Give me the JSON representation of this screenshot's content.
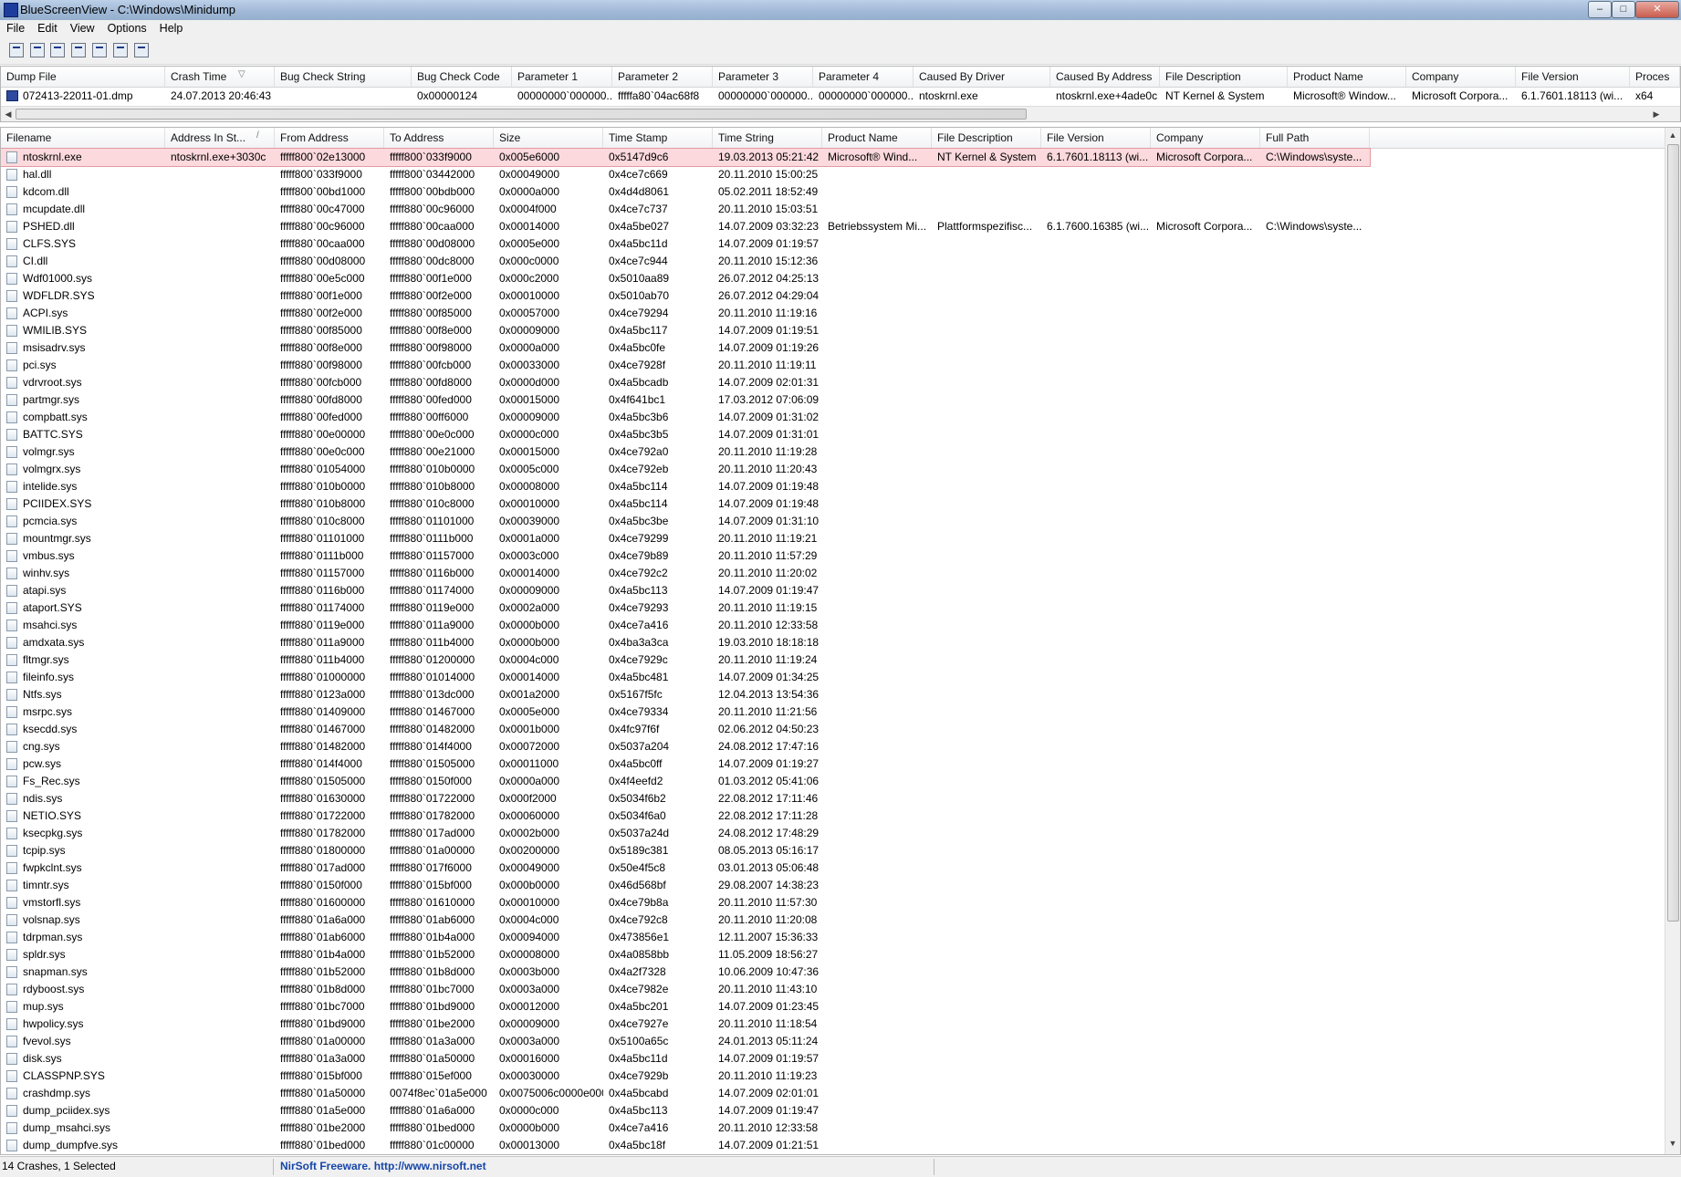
{
  "window": {
    "title": "BlueScreenView  -  C:\\Windows\\Minidump",
    "minimize": "–",
    "maximize": "□",
    "close": "✕"
  },
  "menu": [
    "File",
    "Edit",
    "View",
    "Options",
    "Help"
  ],
  "toolbar": [
    "save-icon",
    "save-selected-icon",
    "refresh-icon",
    "copy-icon",
    "properties-icon",
    "find-icon",
    "exit-icon"
  ],
  "dumps": {
    "columns": [
      "Dump File",
      "Crash Time",
      "Bug Check String",
      "Bug Check Code",
      "Parameter 1",
      "Parameter 2",
      "Parameter 3",
      "Parameter 4",
      "Caused By Driver",
      "Caused By Address",
      "File Description",
      "Product Name",
      "Company",
      "File Version",
      "Proces"
    ],
    "sort_indicator": "▽",
    "rows": [
      [
        "072413-22011-01.dmp",
        "24.07.2013 20:46:43",
        "",
        "0x00000124",
        "00000000`000000...",
        "fffffa80`04ac68f8",
        "00000000`000000...",
        "00000000`000000...",
        "ntoskrnl.exe",
        "ntoskrnl.exe+4ade0c",
        "NT Kernel & System",
        "Microsoft® Window...",
        "Microsoft Corpora...",
        "6.1.7601.18113 (wi...",
        "x64"
      ]
    ]
  },
  "drivers": {
    "columns": [
      "Filename",
      "Address In St...",
      "From Address",
      "To Address",
      "Size",
      "Time Stamp",
      "Time String",
      "Product Name",
      "File Description",
      "File Version",
      "Company",
      "Full Path"
    ],
    "sort_indicator": "/",
    "rows": [
      [
        "ntoskrnl.exe",
        "ntoskrnl.exe+3030c",
        "fffff800`02e13000",
        "fffff800`033f9000",
        "0x005e6000",
        "0x5147d9c6",
        "19.03.2013 05:21:42",
        "Microsoft® Wind...",
        "NT Kernel & System",
        "6.1.7601.18113 (wi...",
        "Microsoft Corpora...",
        "C:\\Windows\\syste..."
      ],
      [
        "hal.dll",
        "",
        "fffff800`033f9000",
        "fffff800`03442000",
        "0x00049000",
        "0x4ce7c669",
        "20.11.2010 15:00:25",
        "",
        "",
        "",
        "",
        ""
      ],
      [
        "kdcom.dll",
        "",
        "fffff800`00bd1000",
        "fffff800`00bdb000",
        "0x0000a000",
        "0x4d4d8061",
        "05.02.2011 18:52:49",
        "",
        "",
        "",
        "",
        ""
      ],
      [
        "mcupdate.dll",
        "",
        "fffff880`00c47000",
        "fffff880`00c96000",
        "0x0004f000",
        "0x4ce7c737",
        "20.11.2010 15:03:51",
        "",
        "",
        "",
        "",
        ""
      ],
      [
        "PSHED.dll",
        "",
        "fffff880`00c96000",
        "fffff880`00caa000",
        "0x00014000",
        "0x4a5be027",
        "14.07.2009 03:32:23",
        "Betriebssystem Mi...",
        "Plattformspezifisc...",
        "6.1.7600.16385 (wi...",
        "Microsoft Corpora...",
        "C:\\Windows\\syste..."
      ],
      [
        "CLFS.SYS",
        "",
        "fffff880`00caa000",
        "fffff880`00d08000",
        "0x0005e000",
        "0x4a5bc11d",
        "14.07.2009 01:19:57",
        "",
        "",
        "",
        "",
        ""
      ],
      [
        "CI.dll",
        "",
        "fffff880`00d08000",
        "fffff880`00dc8000",
        "0x000c0000",
        "0x4ce7c944",
        "20.11.2010 15:12:36",
        "",
        "",
        "",
        "",
        ""
      ],
      [
        "Wdf01000.sys",
        "",
        "fffff880`00e5c000",
        "fffff880`00f1e000",
        "0x000c2000",
        "0x5010aa89",
        "26.07.2012 04:25:13",
        "",
        "",
        "",
        "",
        ""
      ],
      [
        "WDFLDR.SYS",
        "",
        "fffff880`00f1e000",
        "fffff880`00f2e000",
        "0x00010000",
        "0x5010ab70",
        "26.07.2012 04:29:04",
        "",
        "",
        "",
        "",
        ""
      ],
      [
        "ACPI.sys",
        "",
        "fffff880`00f2e000",
        "fffff880`00f85000",
        "0x00057000",
        "0x4ce79294",
        "20.11.2010 11:19:16",
        "",
        "",
        "",
        "",
        ""
      ],
      [
        "WMILIB.SYS",
        "",
        "fffff880`00f85000",
        "fffff880`00f8e000",
        "0x00009000",
        "0x4a5bc117",
        "14.07.2009 01:19:51",
        "",
        "",
        "",
        "",
        ""
      ],
      [
        "msisadrv.sys",
        "",
        "fffff880`00f8e000",
        "fffff880`00f98000",
        "0x0000a000",
        "0x4a5bc0fe",
        "14.07.2009 01:19:26",
        "",
        "",
        "",
        "",
        ""
      ],
      [
        "pci.sys",
        "",
        "fffff880`00f98000",
        "fffff880`00fcb000",
        "0x00033000",
        "0x4ce7928f",
        "20.11.2010 11:19:11",
        "",
        "",
        "",
        "",
        ""
      ],
      [
        "vdrvroot.sys",
        "",
        "fffff880`00fcb000",
        "fffff880`00fd8000",
        "0x0000d000",
        "0x4a5bcadb",
        "14.07.2009 02:01:31",
        "",
        "",
        "",
        "",
        ""
      ],
      [
        "partmgr.sys",
        "",
        "fffff880`00fd8000",
        "fffff880`00fed000",
        "0x00015000",
        "0x4f641bc1",
        "17.03.2012 07:06:09",
        "",
        "",
        "",
        "",
        ""
      ],
      [
        "compbatt.sys",
        "",
        "fffff880`00fed000",
        "fffff880`00ff6000",
        "0x00009000",
        "0x4a5bc3b6",
        "14.07.2009 01:31:02",
        "",
        "",
        "",
        "",
        ""
      ],
      [
        "BATTC.SYS",
        "",
        "fffff880`00e00000",
        "fffff880`00e0c000",
        "0x0000c000",
        "0x4a5bc3b5",
        "14.07.2009 01:31:01",
        "",
        "",
        "",
        "",
        ""
      ],
      [
        "volmgr.sys",
        "",
        "fffff880`00e0c000",
        "fffff880`00e21000",
        "0x00015000",
        "0x4ce792a0",
        "20.11.2010 11:19:28",
        "",
        "",
        "",
        "",
        ""
      ],
      [
        "volmgrx.sys",
        "",
        "fffff880`01054000",
        "fffff880`010b0000",
        "0x0005c000",
        "0x4ce792eb",
        "20.11.2010 11:20:43",
        "",
        "",
        "",
        "",
        ""
      ],
      [
        "intelide.sys",
        "",
        "fffff880`010b0000",
        "fffff880`010b8000",
        "0x00008000",
        "0x4a5bc114",
        "14.07.2009 01:19:48",
        "",
        "",
        "",
        "",
        ""
      ],
      [
        "PCIIDEX.SYS",
        "",
        "fffff880`010b8000",
        "fffff880`010c8000",
        "0x00010000",
        "0x4a5bc114",
        "14.07.2009 01:19:48",
        "",
        "",
        "",
        "",
        ""
      ],
      [
        "pcmcia.sys",
        "",
        "fffff880`010c8000",
        "fffff880`01101000",
        "0x00039000",
        "0x4a5bc3be",
        "14.07.2009 01:31:10",
        "",
        "",
        "",
        "",
        ""
      ],
      [
        "mountmgr.sys",
        "",
        "fffff880`01101000",
        "fffff880`0111b000",
        "0x0001a000",
        "0x4ce79299",
        "20.11.2010 11:19:21",
        "",
        "",
        "",
        "",
        ""
      ],
      [
        "vmbus.sys",
        "",
        "fffff880`0111b000",
        "fffff880`01157000",
        "0x0003c000",
        "0x4ce79b89",
        "20.11.2010 11:57:29",
        "",
        "",
        "",
        "",
        ""
      ],
      [
        "winhv.sys",
        "",
        "fffff880`01157000",
        "fffff880`0116b000",
        "0x00014000",
        "0x4ce792c2",
        "20.11.2010 11:20:02",
        "",
        "",
        "",
        "",
        ""
      ],
      [
        "atapi.sys",
        "",
        "fffff880`0116b000",
        "fffff880`01174000",
        "0x00009000",
        "0x4a5bc113",
        "14.07.2009 01:19:47",
        "",
        "",
        "",
        "",
        ""
      ],
      [
        "ataport.SYS",
        "",
        "fffff880`01174000",
        "fffff880`0119e000",
        "0x0002a000",
        "0x4ce79293",
        "20.11.2010 11:19:15",
        "",
        "",
        "",
        "",
        ""
      ],
      [
        "msahci.sys",
        "",
        "fffff880`0119e000",
        "fffff880`011a9000",
        "0x0000b000",
        "0x4ce7a416",
        "20.11.2010 12:33:58",
        "",
        "",
        "",
        "",
        ""
      ],
      [
        "amdxata.sys",
        "",
        "fffff880`011a9000",
        "fffff880`011b4000",
        "0x0000b000",
        "0x4ba3a3ca",
        "19.03.2010 18:18:18",
        "",
        "",
        "",
        "",
        ""
      ],
      [
        "fltmgr.sys",
        "",
        "fffff880`011b4000",
        "fffff880`01200000",
        "0x0004c000",
        "0x4ce7929c",
        "20.11.2010 11:19:24",
        "",
        "",
        "",
        "",
        ""
      ],
      [
        "fileinfo.sys",
        "",
        "fffff880`01000000",
        "fffff880`01014000",
        "0x00014000",
        "0x4a5bc481",
        "14.07.2009 01:34:25",
        "",
        "",
        "",
        "",
        ""
      ],
      [
        "Ntfs.sys",
        "",
        "fffff880`0123a000",
        "fffff880`013dc000",
        "0x001a2000",
        "0x5167f5fc",
        "12.04.2013 13:54:36",
        "",
        "",
        "",
        "",
        ""
      ],
      [
        "msrpc.sys",
        "",
        "fffff880`01409000",
        "fffff880`01467000",
        "0x0005e000",
        "0x4ce79334",
        "20.11.2010 11:21:56",
        "",
        "",
        "",
        "",
        ""
      ],
      [
        "ksecdd.sys",
        "",
        "fffff880`01467000",
        "fffff880`01482000",
        "0x0001b000",
        "0x4fc97f6f",
        "02.06.2012 04:50:23",
        "",
        "",
        "",
        "",
        ""
      ],
      [
        "cng.sys",
        "",
        "fffff880`01482000",
        "fffff880`014f4000",
        "0x00072000",
        "0x5037a204",
        "24.08.2012 17:47:16",
        "",
        "",
        "",
        "",
        ""
      ],
      [
        "pcw.sys",
        "",
        "fffff880`014f4000",
        "fffff880`01505000",
        "0x00011000",
        "0x4a5bc0ff",
        "14.07.2009 01:19:27",
        "",
        "",
        "",
        "",
        ""
      ],
      [
        "Fs_Rec.sys",
        "",
        "fffff880`01505000",
        "fffff880`0150f000",
        "0x0000a000",
        "0x4f4eefd2",
        "01.03.2012 05:41:06",
        "",
        "",
        "",
        "",
        ""
      ],
      [
        "ndis.sys",
        "",
        "fffff880`01630000",
        "fffff880`01722000",
        "0x000f2000",
        "0x5034f6b2",
        "22.08.2012 17:11:46",
        "",
        "",
        "",
        "",
        ""
      ],
      [
        "NETIO.SYS",
        "",
        "fffff880`01722000",
        "fffff880`01782000",
        "0x00060000",
        "0x5034f6a0",
        "22.08.2012 17:11:28",
        "",
        "",
        "",
        "",
        ""
      ],
      [
        "ksecpkg.sys",
        "",
        "fffff880`01782000",
        "fffff880`017ad000",
        "0x0002b000",
        "0x5037a24d",
        "24.08.2012 17:48:29",
        "",
        "",
        "",
        "",
        ""
      ],
      [
        "tcpip.sys",
        "",
        "fffff880`01800000",
        "fffff880`01a00000",
        "0x00200000",
        "0x5189c381",
        "08.05.2013 05:16:17",
        "",
        "",
        "",
        "",
        ""
      ],
      [
        "fwpkclnt.sys",
        "",
        "fffff880`017ad000",
        "fffff880`017f6000",
        "0x00049000",
        "0x50e4f5c8",
        "03.01.2013 05:06:48",
        "",
        "",
        "",
        "",
        ""
      ],
      [
        "timntr.sys",
        "",
        "fffff880`0150f000",
        "fffff880`015bf000",
        "0x000b0000",
        "0x46d568bf",
        "29.08.2007 14:38:23",
        "",
        "",
        "",
        "",
        ""
      ],
      [
        "vmstorfl.sys",
        "",
        "fffff880`01600000",
        "fffff880`01610000",
        "0x00010000",
        "0x4ce79b8a",
        "20.11.2010 11:57:30",
        "",
        "",
        "",
        "",
        ""
      ],
      [
        "volsnap.sys",
        "",
        "fffff880`01a6a000",
        "fffff880`01ab6000",
        "0x0004c000",
        "0x4ce792c8",
        "20.11.2010 11:20:08",
        "",
        "",
        "",
        "",
        ""
      ],
      [
        "tdrpman.sys",
        "",
        "fffff880`01ab6000",
        "fffff880`01b4a000",
        "0x00094000",
        "0x473856e1",
        "12.11.2007 15:36:33",
        "",
        "",
        "",
        "",
        ""
      ],
      [
        "spldr.sys",
        "",
        "fffff880`01b4a000",
        "fffff880`01b52000",
        "0x00008000",
        "0x4a0858bb",
        "11.05.2009 18:56:27",
        "",
        "",
        "",
        "",
        ""
      ],
      [
        "snapman.sys",
        "",
        "fffff880`01b52000",
        "fffff880`01b8d000",
        "0x0003b000",
        "0x4a2f7328",
        "10.06.2009 10:47:36",
        "",
        "",
        "",
        "",
        ""
      ],
      [
        "rdyboost.sys",
        "",
        "fffff880`01b8d000",
        "fffff880`01bc7000",
        "0x0003a000",
        "0x4ce7982e",
        "20.11.2010 11:43:10",
        "",
        "",
        "",
        "",
        ""
      ],
      [
        "mup.sys",
        "",
        "fffff880`01bc7000",
        "fffff880`01bd9000",
        "0x00012000",
        "0x4a5bc201",
        "14.07.2009 01:23:45",
        "",
        "",
        "",
        "",
        ""
      ],
      [
        "hwpolicy.sys",
        "",
        "fffff880`01bd9000",
        "fffff880`01be2000",
        "0x00009000",
        "0x4ce7927e",
        "20.11.2010 11:18:54",
        "",
        "",
        "",
        "",
        ""
      ],
      [
        "fvevol.sys",
        "",
        "fffff880`01a00000",
        "fffff880`01a3a000",
        "0x0003a000",
        "0x5100a65c",
        "24.01.2013 05:11:24",
        "",
        "",
        "",
        "",
        ""
      ],
      [
        "disk.sys",
        "",
        "fffff880`01a3a000",
        "fffff880`01a50000",
        "0x00016000",
        "0x4a5bc11d",
        "14.07.2009 01:19:57",
        "",
        "",
        "",
        "",
        ""
      ],
      [
        "CLASSPNP.SYS",
        "",
        "fffff880`015bf000",
        "fffff880`015ef000",
        "0x00030000",
        "0x4ce7929b",
        "20.11.2010 11:19:23",
        "",
        "",
        "",
        "",
        ""
      ],
      [
        "crashdmp.sys",
        "",
        "fffff880`01a50000",
        "0074f8ec`01a5e000",
        "0x0075006c0000e000",
        "0x4a5bcabd",
        "14.07.2009 02:01:01",
        "",
        "",
        "",
        "",
        ""
      ],
      [
        "dump_pciidex.sys",
        "",
        "fffff880`01a5e000",
        "fffff880`01a6a000",
        "0x0000c000",
        "0x4a5bc113",
        "14.07.2009 01:19:47",
        "",
        "",
        "",
        "",
        ""
      ],
      [
        "dump_msahci.sys",
        "",
        "fffff880`01be2000",
        "fffff880`01bed000",
        "0x0000b000",
        "0x4ce7a416",
        "20.11.2010 12:33:58",
        "",
        "",
        "",
        "",
        ""
      ],
      [
        "dump_dumpfve.sys",
        "",
        "fffff880`01bed000",
        "fffff880`01c00000",
        "0x00013000",
        "0x4a5bc18f",
        "14.07.2009 01:21:51",
        "",
        "",
        "",
        "",
        ""
      ]
    ]
  },
  "status": {
    "counts": "14 Crashes, 1 Selected",
    "credit": "NirSoft Freeware.  http://www.nirsoft.net"
  }
}
